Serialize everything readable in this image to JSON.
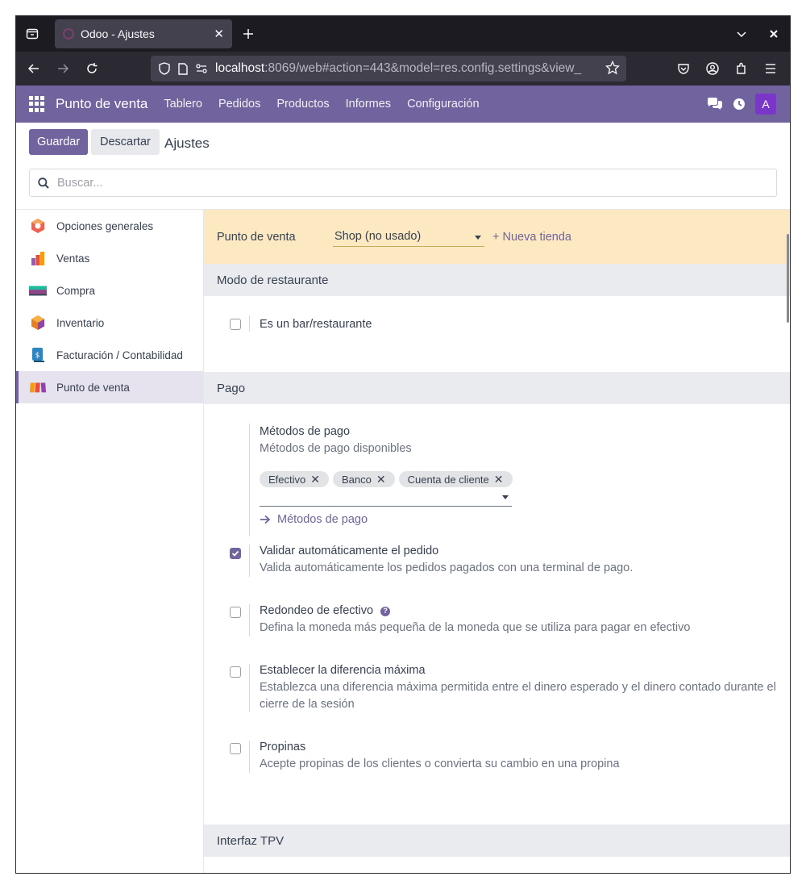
{
  "browser": {
    "tab_title": "Odoo - Ajustes",
    "tab_close": "✕",
    "url_host": "localhost",
    "url_rest": ":8069/web#action=443&model=res.config.settings&view_"
  },
  "odoo_nav": {
    "brand": "Punto de venta",
    "menu": [
      "Tablero",
      "Pedidos",
      "Productos",
      "Informes",
      "Configuración"
    ],
    "avatar": "A"
  },
  "control_panel": {
    "save_label": "Guardar",
    "discard_label": "Descartar",
    "breadcrumb": "Ajustes",
    "search_placeholder": "Buscar..."
  },
  "sidebar": {
    "items": [
      {
        "label": "Opciones generales",
        "icon": "general-settings-icon"
      },
      {
        "label": "Ventas",
        "icon": "sales-icon"
      },
      {
        "label": "Compra",
        "icon": "purchase-icon"
      },
      {
        "label": "Inventario",
        "icon": "inventory-icon"
      },
      {
        "label": "Facturación / Contabilidad",
        "icon": "invoicing-icon"
      },
      {
        "label": "Punto de venta",
        "icon": "point-of-sale-icon",
        "active": true
      }
    ]
  },
  "banner": {
    "label": "Punto de venta",
    "selected_shop": "Shop (no usado)",
    "new_shop": "+ Nueva tienda"
  },
  "sections": {
    "restaurant": {
      "title": "Modo de restaurante",
      "setting": {
        "title": "Es un bar/restaurante",
        "checked": false
      }
    },
    "payment": {
      "title": "Pago",
      "methods": {
        "title": "Métodos de pago",
        "desc": "Métodos de pago disponibles",
        "tags": [
          "Efectivo",
          "Banco",
          "Cuenta de cliente"
        ],
        "link": "Métodos de pago"
      },
      "auto_validate": {
        "title": "Validar automáticamente el pedido",
        "desc": "Valida automáticamente los pedidos pagados con una terminal de pago.",
        "checked": true
      },
      "cash_rounding": {
        "title": "Redondeo de efectivo",
        "desc": "Defina la moneda más pequeña de la moneda que se utiliza para pagar en efectivo",
        "checked": false
      },
      "max_difference": {
        "title": "Establecer la diferencia máxima",
        "desc_line1": "Establezca una diferencia máxima permitida entre el dinero esperado y el dinero contado durante el",
        "desc_line2": "cierre de la sesión",
        "checked": false
      },
      "tips": {
        "title": "Propinas",
        "desc": "Acepte propinas de los clientes o convierta su cambio en una propina",
        "checked": false
      }
    },
    "pos_interface": {
      "title": "Interfaz TPV"
    }
  },
  "colors": {
    "brand": "#71639e",
    "banner": "#fce9c2",
    "section_bg": "#e9ebee"
  }
}
